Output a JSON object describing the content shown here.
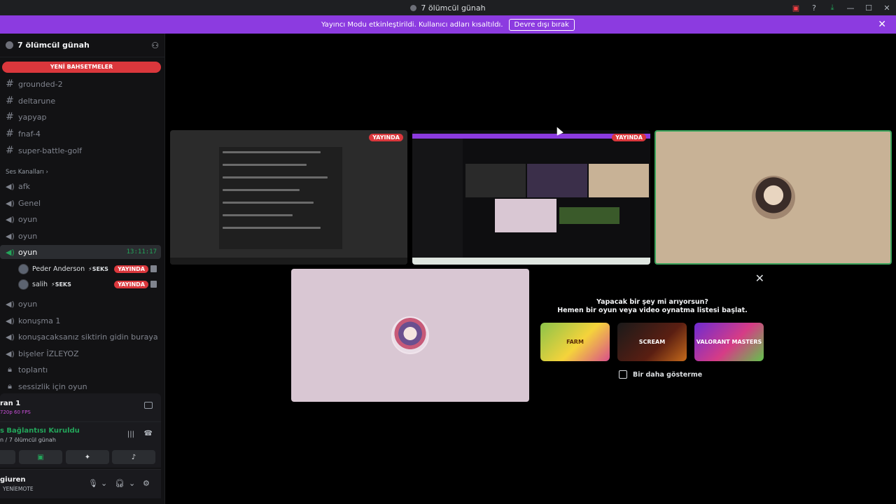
{
  "window": {
    "title": "7 ölümcül günah"
  },
  "banner": {
    "text": "Yayıncı Modu etkinleştirildi. Kullanıcı adları kısaltıldı.",
    "button_label": "Devre dışı bırak"
  },
  "server": {
    "name": "7 ölümcül günah",
    "new_mentions": "YENİ BAHSETMELER"
  },
  "text_channels": [
    "grounded-2",
    "deltarune",
    "yapyap",
    "fnaf-4",
    "super-battle-golf"
  ],
  "voice_category": "Ses Kanalları",
  "voice_channels": {
    "c1": "afk",
    "c2": "Genel",
    "c3": "oyun",
    "c4": "oyun",
    "active": "oyun",
    "active_timer": "13:11:17",
    "c6": "oyun",
    "c7": "konuşma 1",
    "c8": "konuşacaksanız siktirin gidin buraya",
    "c9": "bişeler İZLEYOZ",
    "c10": "toplantı",
    "c11": "sessizlik için oyun"
  },
  "voice_users": [
    {
      "name": "Peder Anderson",
      "tag": "SEKS",
      "badge": "YAYINDA"
    },
    {
      "name": "salih",
      "tag": "SEKS",
      "badge": "YAYINDA"
    }
  ],
  "stream_panel": {
    "title": "ran 1",
    "quality": "720p 60 FPS"
  },
  "voice_panel": {
    "status": "s Bağlantısı Kuruldu",
    "channel": "n / 7 ölümcül günah"
  },
  "user_panel": {
    "name": "giuren",
    "status": "YENİEMOTE"
  },
  "tiles": {
    "live_badge": "YAYINDA"
  },
  "promo": {
    "line1": "Yapacak bir şey mi arıyorsun?",
    "line2": "Hemen bir oyun veya video oynatma listesi başlat.",
    "cards": [
      "FARM",
      "SCREAM",
      "VALORANT MASTERS"
    ],
    "checkbox_label": "Bir daha gösterme"
  },
  "colors": {
    "accent": "#8c3be0",
    "live": "#da373c",
    "connected": "#23a55a"
  }
}
